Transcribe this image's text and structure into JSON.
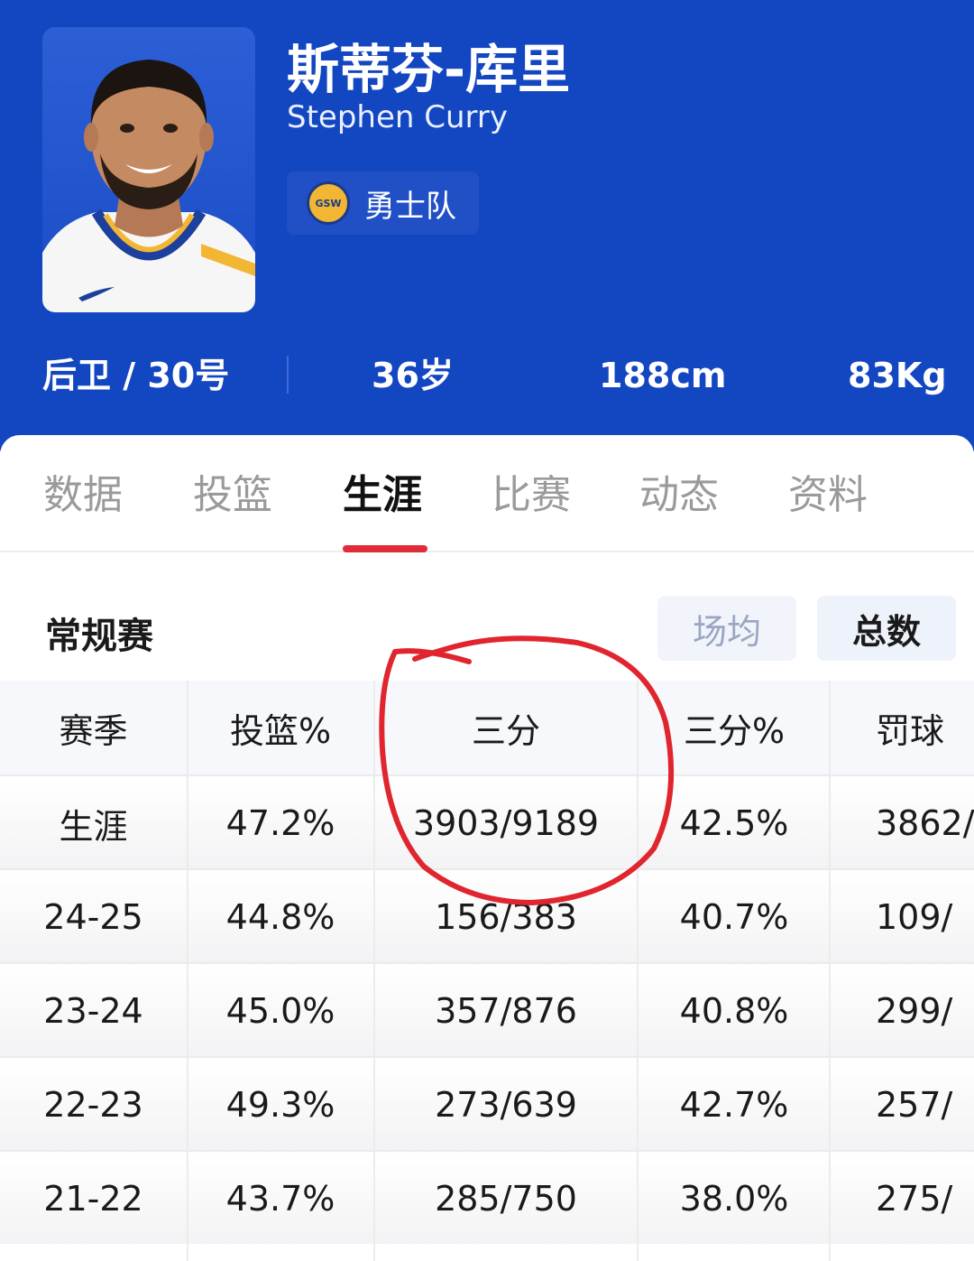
{
  "player": {
    "name_cn": "斯蒂芬-库里",
    "name_en": "Stephen Curry",
    "team": "勇士队",
    "team_logo_text": "GSW",
    "position_number": "后卫 / 30号",
    "age": "36岁",
    "height": "188cm",
    "weight": "83Kg"
  },
  "tabs": [
    "数据",
    "投篮",
    "生涯",
    "比赛",
    "动态",
    "资料"
  ],
  "active_tab": "生涯",
  "section": {
    "title": "常规赛",
    "toggle_avg": "场均",
    "toggle_total": "总数",
    "selected_toggle": "总数"
  },
  "table": {
    "columns": [
      "赛季",
      "投篮%",
      "三分",
      "三分%",
      "罚球"
    ],
    "rows": [
      [
        "生涯",
        "47.2%",
        "3903/9189",
        "42.5%",
        "3862/"
      ],
      [
        "24-25",
        "44.8%",
        "156/383",
        "40.7%",
        "109/"
      ],
      [
        "23-24",
        "45.0%",
        "357/876",
        "40.8%",
        "299/"
      ],
      [
        "22-23",
        "49.3%",
        "273/639",
        "42.7%",
        "257/"
      ],
      [
        "21-22",
        "43.7%",
        "285/750",
        "38.0%",
        "275/"
      ]
    ]
  },
  "colors": {
    "header_bg": "#1346c1",
    "tab_underline": "#e02b3a",
    "annotation_circle": "#e0252e"
  },
  "icons": {
    "team_logo": "gsw-logo-icon",
    "player_photo": "player-photo"
  }
}
